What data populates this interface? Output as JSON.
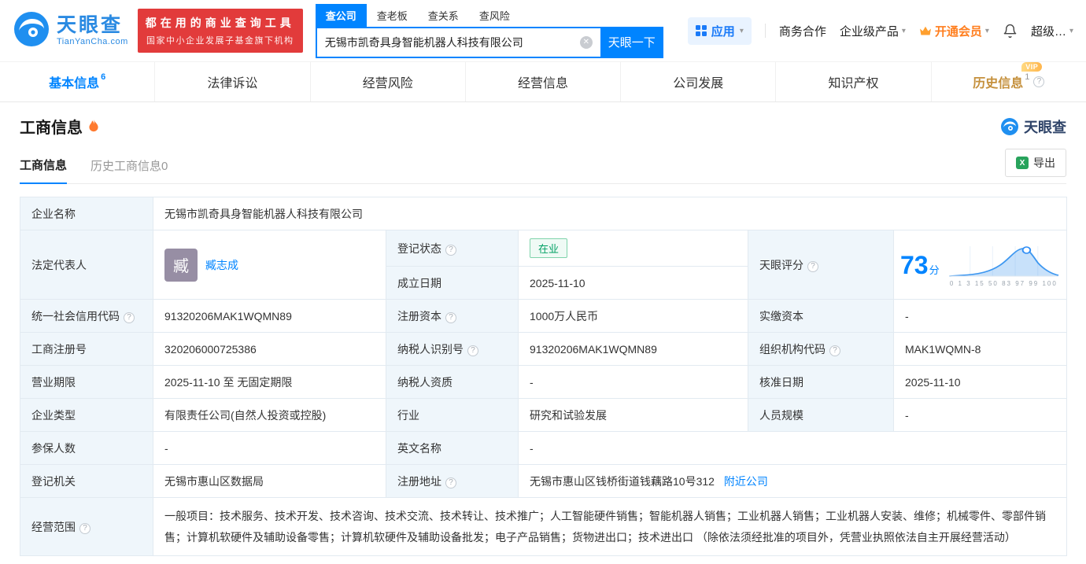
{
  "colors": {
    "primary_blue": "#0084ff",
    "brand_red": "#e23b3b",
    "status_green": "#00a063",
    "vip_orange": "#ff7e1e",
    "history_gold": "#c5903c"
  },
  "icons": {
    "caret_down": "▾",
    "clear": "✕",
    "question": "?",
    "excel": "X"
  },
  "header": {
    "logo": {
      "brand": "天眼查",
      "domain": "TianYanCha.com"
    },
    "slogan": {
      "line1": "都在用的商业查询工具",
      "line2": "国家中小企业发展子基金旗下机构"
    },
    "search": {
      "tabs": [
        {
          "label": "查公司"
        },
        {
          "label": "查老板"
        },
        {
          "label": "查关系"
        },
        {
          "label": "查风险"
        }
      ],
      "value": "无锡市凯奇具身智能机器人科技有限公司",
      "button": "天眼一下"
    },
    "menu": {
      "apps": "应用",
      "cooperation": "商务合作",
      "enterprise_products": "企业级产品",
      "vip": "开通会员",
      "super": "超级…"
    }
  },
  "tabs": [
    {
      "label": "基本信息",
      "count": "6"
    },
    {
      "label": "法律诉讼"
    },
    {
      "label": "经营风险"
    },
    {
      "label": "经营信息"
    },
    {
      "label": "公司发展"
    },
    {
      "label": "知识产权"
    },
    {
      "label": "历史信息",
      "count": "1",
      "badge": "VIP"
    }
  ],
  "section": {
    "title": "工商信息",
    "watermark": "天眼查",
    "subtabs": [
      {
        "label": "工商信息"
      },
      {
        "label": "历史工商信息0"
      }
    ],
    "export_label": "导出"
  },
  "info": {
    "company_name": {
      "label": "企业名称",
      "value": "无锡市凯奇具身智能机器人科技有限公司"
    },
    "legal_rep": {
      "label": "法定代表人",
      "value": "臧志成",
      "avatar": "臧"
    },
    "reg_status": {
      "label": "登记状态",
      "value": "在业"
    },
    "establish_date": {
      "label": "成立日期",
      "value": "2025-11-10"
    },
    "score": {
      "label": "天眼评分",
      "value": "73",
      "unit": "分",
      "axis_ticks": "0 1 3 15 50 83 97 99 100"
    },
    "credit_code": {
      "label": "统一社会信用代码",
      "value": "91320206MAK1WQMN89"
    },
    "reg_capital": {
      "label": "注册资本",
      "value": "1000万人民币"
    },
    "paid_capital": {
      "label": "实缴资本",
      "value": "-"
    },
    "reg_number": {
      "label": "工商注册号",
      "value": "320206000725386"
    },
    "taxpayer_id": {
      "label": "纳税人识别号",
      "value": "91320206MAK1WQMN89"
    },
    "org_code": {
      "label": "组织机构代码",
      "value": "MAK1WQMN-8"
    },
    "business_term": {
      "label": "营业期限",
      "value": "2025-11-10 至 无固定期限"
    },
    "taxpayer_quality": {
      "label": "纳税人资质",
      "value": "-"
    },
    "approval_date": {
      "label": "核准日期",
      "value": "2025-11-10"
    },
    "company_type": {
      "label": "企业类型",
      "value": "有限责任公司(自然人投资或控股)"
    },
    "industry": {
      "label": "行业",
      "value": "研究和试验发展"
    },
    "staff_size": {
      "label": "人员规模",
      "value": "-"
    },
    "insured_count": {
      "label": "参保人数",
      "value": "-"
    },
    "english_name": {
      "label": "英文名称",
      "value": "-"
    },
    "reg_authority": {
      "label": "登记机关",
      "value": "无锡市惠山区数据局"
    },
    "reg_address": {
      "label": "注册地址",
      "value": "无锡市惠山区钱桥街道钱藕路10号312",
      "link": "附近公司"
    },
    "business_scope": {
      "label": "经营范围",
      "value": "一般项目：技术服务、技术开发、技术咨询、技术交流、技术转让、技术推广；人工智能硬件销售；智能机器人销售；工业机器人销售；工业机器人安装、维修；机械零件、零部件销售；计算机软硬件及辅助设备零售；计算机软硬件及辅助设备批发；电子产品销售；货物进出口；技术进出口 （除依法须经批准的项目外，凭营业执照依法自主开展经营活动）"
    }
  }
}
